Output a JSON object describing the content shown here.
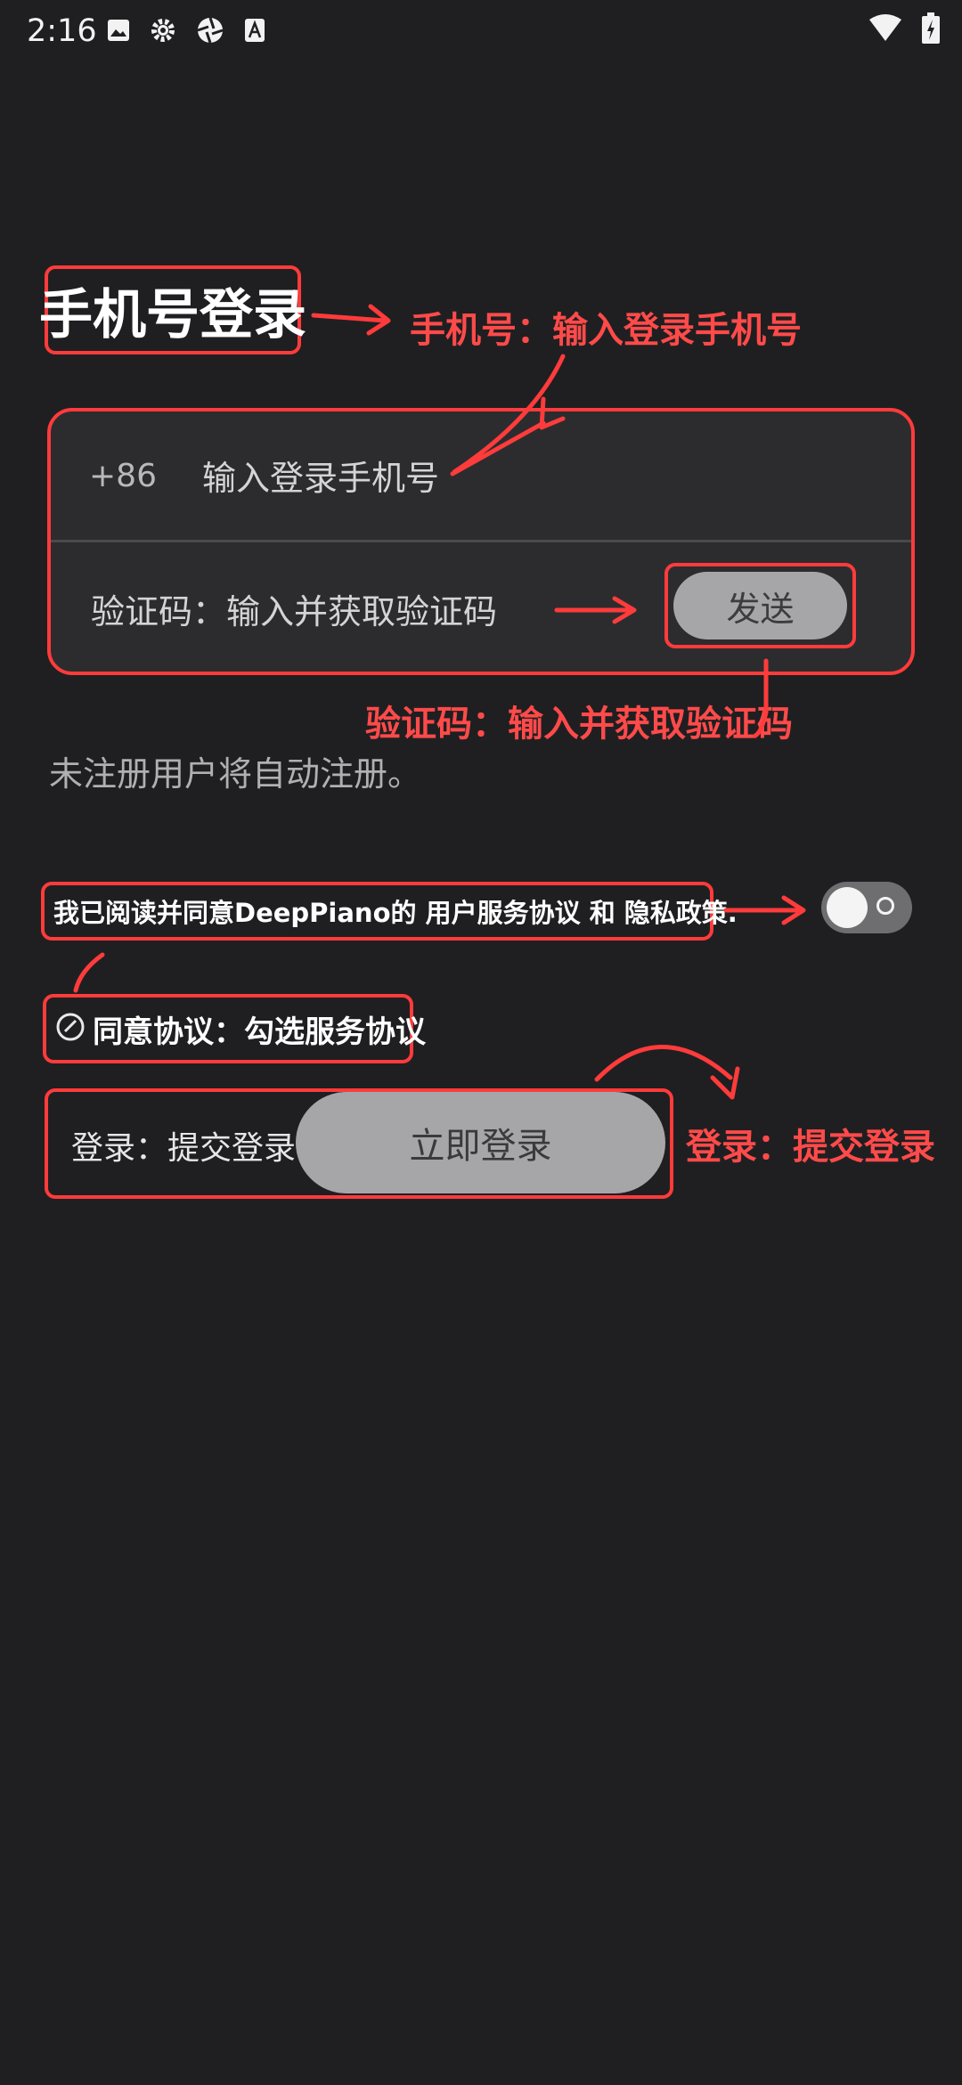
{
  "status_bar": {
    "time": "2:16",
    "left_icons": [
      "image-icon",
      "gear-icon",
      "aperture-icon",
      "font-icon"
    ],
    "right_icons": [
      "wifi-icon",
      "battery-charging-icon"
    ]
  },
  "page_title": "手机号登录",
  "phone_field": {
    "country_code": "+86",
    "placeholder": "输入登录手机号"
  },
  "code_field": {
    "placeholder": "验证码：输入并获取验证码",
    "send_label": "发送"
  },
  "notice": "未注册用户将自动注册。",
  "agreement": {
    "text": "我已阅读并同意DeepPiano的 用户服务协议 和 隐私政策.",
    "toggle_on": false
  },
  "consent": {
    "label": "同意协议：勾选服务协议"
  },
  "login": {
    "label": "登录：提交登录",
    "button_label": "立即登录"
  },
  "annotations": {
    "phone_note": "手机号：输入登录手机号",
    "code_note": "验证码：输入并获取验证码",
    "submit_note": "登录：提交登录",
    "color": "#ff3b3b"
  }
}
